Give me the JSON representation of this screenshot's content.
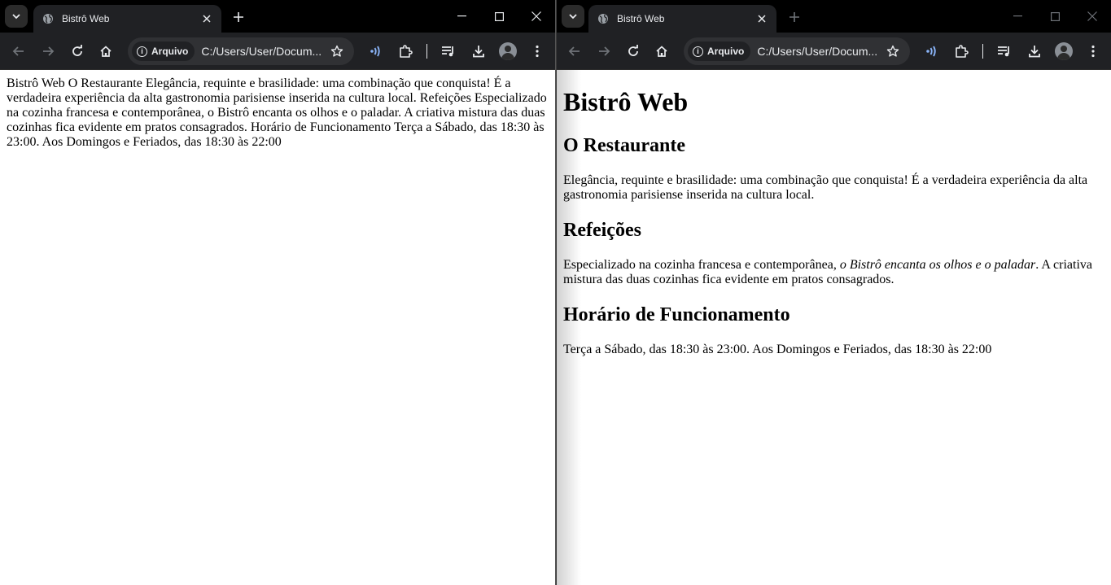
{
  "browser": {
    "tab_title": "Bistrô Web",
    "security_chip": "Arquivo",
    "url": "C:/Users/User/Docum..."
  },
  "page": {
    "title": "Bistrô Web",
    "section_restaurant": "O Restaurante",
    "restaurant_text": "Elegância, requinte e brasilidade: uma combinação que conquista! É a verdadeira experiência da alta gastronomia parisiense inserida na cultura local.",
    "section_meals": "Refeições",
    "meals_text_start": "Especializado na cozinha francesa e contemporânea, ",
    "meals_text_emphasis": "o Bistrô encanta os olhos e o paladar",
    "meals_text_end": ". A criativa mistura das duas cozinhas fica evidente em pratos consagrados.",
    "section_hours": "Horário de Funcionamento",
    "hours_text": "Terça a Sábado, das 18:30 às 23:00. Aos Domingos e Feriados, das 18:30 às 22:00"
  },
  "plain_page": {
    "meals_text": "Especializado na cozinha francesa e contemporânea, o Bistrô encanta os olhos e o paladar. A criativa mistura das duas cozinhas fica evidente em pratos consagrados."
  },
  "icons": {
    "favicon": "globe-icon",
    "accent": "#8ab4f8"
  }
}
